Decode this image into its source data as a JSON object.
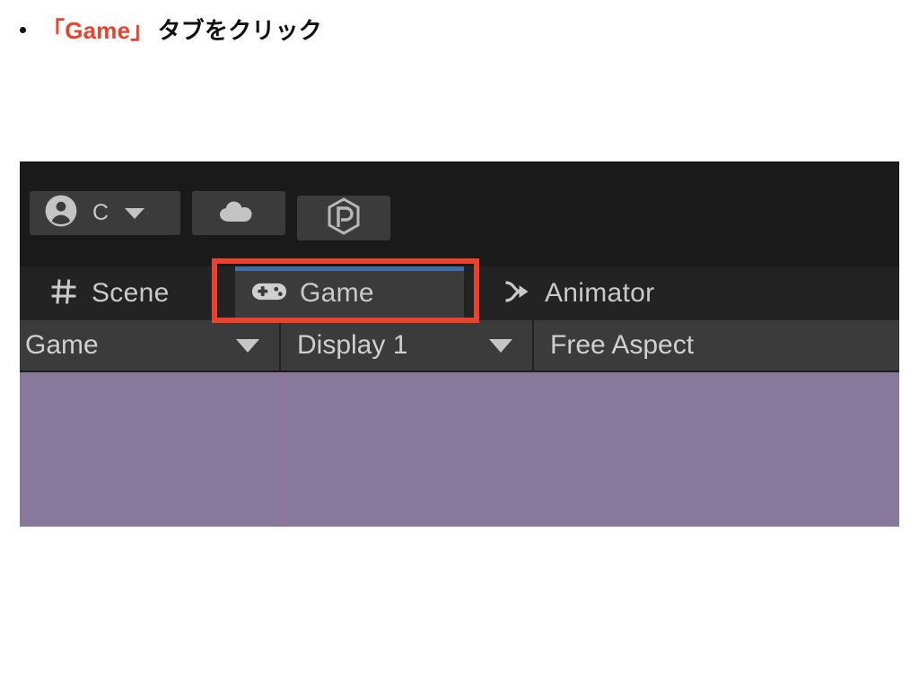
{
  "instruction": {
    "bullet": "•",
    "target": "「Game」",
    "suffix": "タブをクリック"
  },
  "colors": {
    "accent_red": "#e8432e",
    "active_tab_blue": "#3f6ea6",
    "game_view_purple": "#87799b",
    "game_view_line": "#966f9d",
    "toolbar_bg": "#1a1a1a",
    "tab_strip_bg": "#232323",
    "control_bar_bg": "#3b3b3b",
    "text_light": "#c9c9c9"
  },
  "editor": {
    "toolbar": {
      "account_button": {
        "icon": "account-person-icon",
        "label": "C",
        "caret": "chevron-down-icon"
      },
      "cloud_button": {
        "icon": "cloud-icon"
      },
      "packages_button": {
        "icon": "unity-package-hexagon-icon"
      }
    },
    "tabs": [
      {
        "label": "Scene",
        "icon": "grid-hash-icon",
        "active": false
      },
      {
        "label": "Game",
        "icon": "gamepad-icon",
        "active": true
      },
      {
        "label": "Animator",
        "icon": "animator-arrow-icon",
        "active": false
      }
    ],
    "game_view_toolbar": [
      {
        "label": "Game",
        "caret": "chevron-down-icon"
      },
      {
        "label": "Display 1",
        "caret": "chevron-down-icon"
      },
      {
        "label": "Free Aspect",
        "caret": ""
      }
    ]
  },
  "annotation": {
    "shape": "rectangle",
    "color": "#e8432e",
    "targets_tab": "Game"
  }
}
